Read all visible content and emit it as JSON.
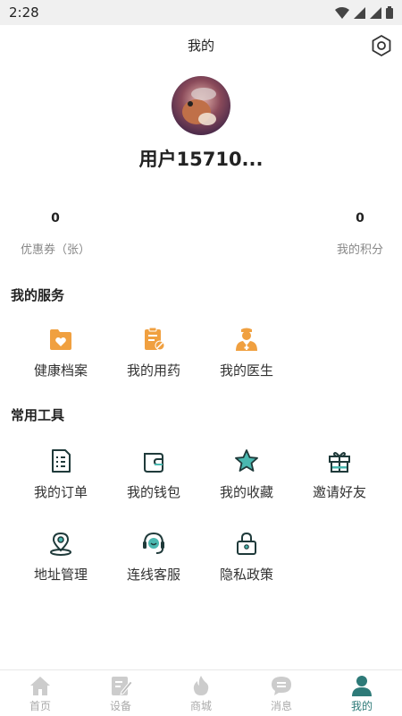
{
  "status_bar": {
    "time": "2:28"
  },
  "header": {
    "title": "我的"
  },
  "profile": {
    "username": "用户15710..."
  },
  "stats": [
    {
      "value": "0",
      "label": "优惠券（张）"
    },
    {
      "value": "0",
      "label": "我的积分"
    }
  ],
  "services": {
    "title": "我的服务",
    "items": [
      {
        "label": "健康档案",
        "icon": "health-record-icon"
      },
      {
        "label": "我的用药",
        "icon": "medication-icon"
      },
      {
        "label": "我的医生",
        "icon": "doctor-icon"
      }
    ]
  },
  "tools": {
    "title": "常用工具",
    "items": [
      {
        "label": "我的订单",
        "icon": "order-icon"
      },
      {
        "label": "我的钱包",
        "icon": "wallet-icon"
      },
      {
        "label": "我的收藏",
        "icon": "star-icon"
      },
      {
        "label": "邀请好友",
        "icon": "gift-icon"
      },
      {
        "label": "地址管理",
        "icon": "location-icon"
      },
      {
        "label": "连线客服",
        "icon": "headset-icon"
      },
      {
        "label": "隐私政策",
        "icon": "lock-icon"
      }
    ]
  },
  "tab_bar": {
    "tabs": [
      {
        "label": "首页",
        "icon": "home-icon"
      },
      {
        "label": "设备",
        "icon": "device-icon"
      },
      {
        "label": "商城",
        "icon": "mall-icon"
      },
      {
        "label": "消息",
        "icon": "message-icon"
      },
      {
        "label": "我的",
        "icon": "profile-icon",
        "active": true
      }
    ],
    "active_color": "#2d7a78",
    "inactive_color": "#cccccc"
  },
  "colors": {
    "service_orange": "#f0a040",
    "tool_stroke": "#1f3a3a",
    "accent": "#4ab8b0"
  }
}
